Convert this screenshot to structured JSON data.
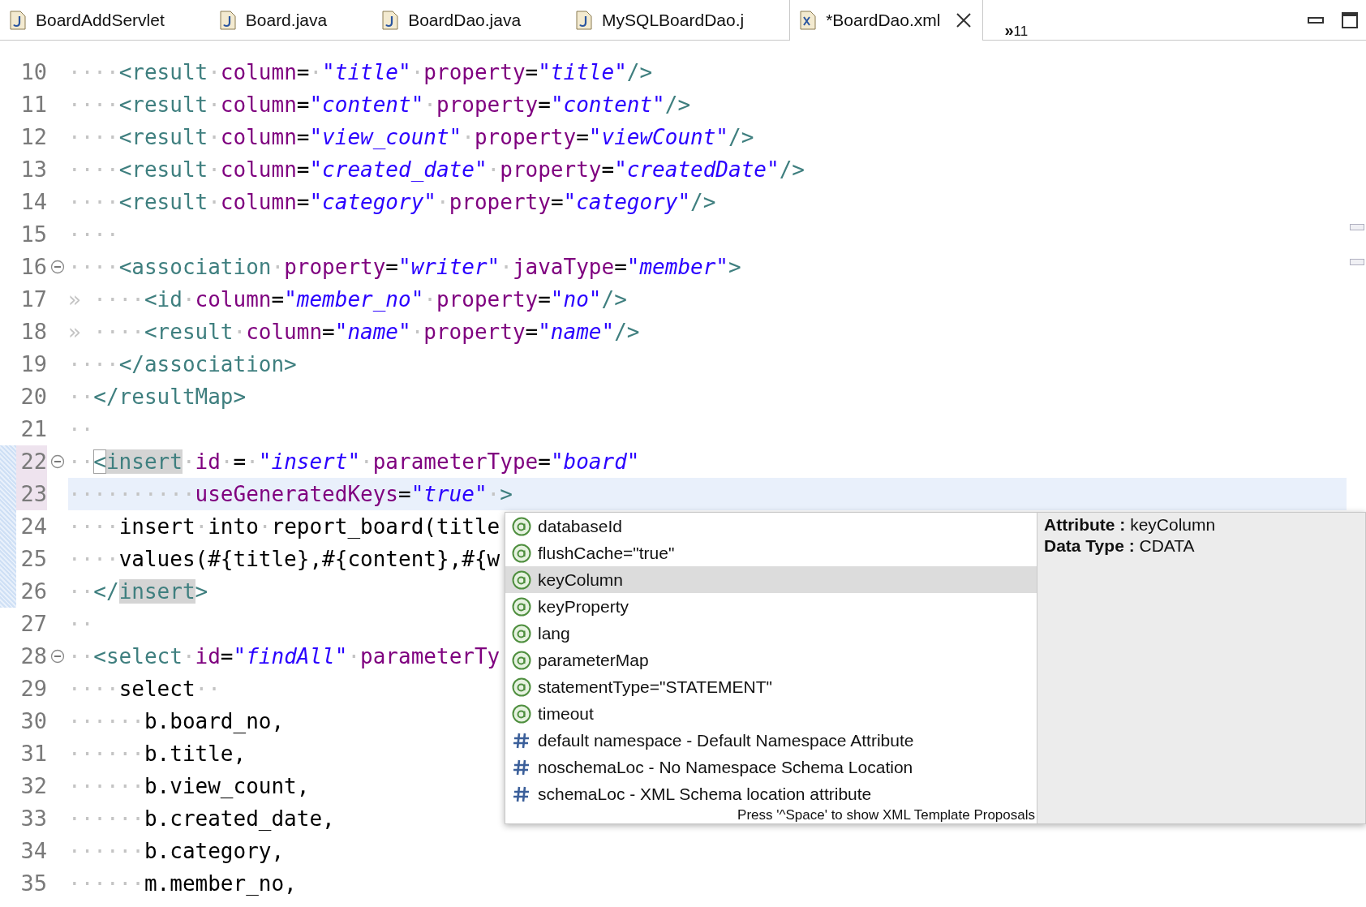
{
  "tabs": [
    {
      "label": "BoardAddServlet",
      "kind": "java",
      "selected": false
    },
    {
      "label": "Board.java",
      "kind": "java",
      "selected": false
    },
    {
      "label": "BoardDao.java",
      "kind": "java",
      "selected": false
    },
    {
      "label": "MySQLBoardDao.j",
      "kind": "java",
      "selected": false
    },
    {
      "label": "*BoardDao.xml",
      "kind": "xml",
      "selected": true
    }
  ],
  "overflow": {
    "chevron": "»",
    "count": "11"
  },
  "lines": [
    {
      "number": "10",
      "fold": false,
      "changed": false,
      "highlighted": false,
      "current": false,
      "tokens": [
        {
          "kind": "ws",
          "text": "····"
        },
        {
          "kind": "tag",
          "text": "<result"
        },
        {
          "kind": "ws",
          "text": "·"
        },
        {
          "kind": "attr",
          "text": "column"
        },
        {
          "kind": "plain",
          "text": "="
        },
        {
          "kind": "ws",
          "text": "·"
        },
        {
          "kind": "value",
          "text": "\"title\""
        },
        {
          "kind": "ws",
          "text": "·"
        },
        {
          "kind": "attr",
          "text": "property"
        },
        {
          "kind": "plain",
          "text": "="
        },
        {
          "kind": "value",
          "text": "\"title\""
        },
        {
          "kind": "tag",
          "text": "/>"
        }
      ]
    },
    {
      "number": "11",
      "fold": false,
      "changed": false,
      "highlighted": false,
      "current": false,
      "tokens": [
        {
          "kind": "ws",
          "text": "····"
        },
        {
          "kind": "tag",
          "text": "<result"
        },
        {
          "kind": "ws",
          "text": "·"
        },
        {
          "kind": "attr",
          "text": "column"
        },
        {
          "kind": "plain",
          "text": "="
        },
        {
          "kind": "value",
          "text": "\"content\""
        },
        {
          "kind": "ws",
          "text": "·"
        },
        {
          "kind": "attr",
          "text": "property"
        },
        {
          "kind": "plain",
          "text": "="
        },
        {
          "kind": "value",
          "text": "\"content\""
        },
        {
          "kind": "tag",
          "text": "/>"
        }
      ]
    },
    {
      "number": "12",
      "fold": false,
      "changed": false,
      "highlighted": false,
      "current": false,
      "tokens": [
        {
          "kind": "ws",
          "text": "····"
        },
        {
          "kind": "tag",
          "text": "<result"
        },
        {
          "kind": "ws",
          "text": "·"
        },
        {
          "kind": "attr",
          "text": "column"
        },
        {
          "kind": "plain",
          "text": "="
        },
        {
          "kind": "value",
          "text": "\"view_count\""
        },
        {
          "kind": "ws",
          "text": "·"
        },
        {
          "kind": "attr",
          "text": "property"
        },
        {
          "kind": "plain",
          "text": "="
        },
        {
          "kind": "value",
          "text": "\"viewCount\""
        },
        {
          "kind": "tag",
          "text": "/>"
        }
      ]
    },
    {
      "number": "13",
      "fold": false,
      "changed": false,
      "highlighted": false,
      "current": false,
      "tokens": [
        {
          "kind": "ws",
          "text": "····"
        },
        {
          "kind": "tag",
          "text": "<result"
        },
        {
          "kind": "ws",
          "text": "·"
        },
        {
          "kind": "attr",
          "text": "column"
        },
        {
          "kind": "plain",
          "text": "="
        },
        {
          "kind": "value",
          "text": "\"created_date\""
        },
        {
          "kind": "ws",
          "text": "·"
        },
        {
          "kind": "attr",
          "text": "property"
        },
        {
          "kind": "plain",
          "text": "="
        },
        {
          "kind": "value",
          "text": "\"createdDate\""
        },
        {
          "kind": "tag",
          "text": "/>"
        }
      ]
    },
    {
      "number": "14",
      "fold": false,
      "changed": false,
      "highlighted": false,
      "current": false,
      "tokens": [
        {
          "kind": "ws",
          "text": "····"
        },
        {
          "kind": "tag",
          "text": "<result"
        },
        {
          "kind": "ws",
          "text": "·"
        },
        {
          "kind": "attr",
          "text": "column"
        },
        {
          "kind": "plain",
          "text": "="
        },
        {
          "kind": "value",
          "text": "\"category\""
        },
        {
          "kind": "ws",
          "text": "·"
        },
        {
          "kind": "attr",
          "text": "property"
        },
        {
          "kind": "plain",
          "text": "="
        },
        {
          "kind": "value",
          "text": "\"category\""
        },
        {
          "kind": "tag",
          "text": "/>"
        }
      ]
    },
    {
      "number": "15",
      "fold": false,
      "changed": false,
      "highlighted": false,
      "current": false,
      "tokens": [
        {
          "kind": "ws",
          "text": "····"
        }
      ]
    },
    {
      "number": "16",
      "fold": true,
      "changed": false,
      "highlighted": false,
      "current": false,
      "tokens": [
        {
          "kind": "ws",
          "text": "····"
        },
        {
          "kind": "tag",
          "text": "<association"
        },
        {
          "kind": "ws",
          "text": "·"
        },
        {
          "kind": "attr",
          "text": "property"
        },
        {
          "kind": "plain",
          "text": "="
        },
        {
          "kind": "value",
          "text": "\"writer\""
        },
        {
          "kind": "ws",
          "text": "·"
        },
        {
          "kind": "attr",
          "text": "javaType"
        },
        {
          "kind": "plain",
          "text": "="
        },
        {
          "kind": "value",
          "text": "\"member\""
        },
        {
          "kind": "tag",
          "text": ">"
        }
      ]
    },
    {
      "number": "17",
      "fold": false,
      "changed": false,
      "highlighted": false,
      "current": false,
      "tokens": [
        {
          "kind": "ws",
          "text": "» ····"
        },
        {
          "kind": "tag",
          "text": "<id"
        },
        {
          "kind": "ws",
          "text": "·"
        },
        {
          "kind": "attr",
          "text": "column"
        },
        {
          "kind": "plain",
          "text": "="
        },
        {
          "kind": "value",
          "text": "\"member_no\""
        },
        {
          "kind": "ws",
          "text": "·"
        },
        {
          "kind": "attr",
          "text": "property"
        },
        {
          "kind": "plain",
          "text": "="
        },
        {
          "kind": "value",
          "text": "\"no\""
        },
        {
          "kind": "tag",
          "text": "/>"
        }
      ]
    },
    {
      "number": "18",
      "fold": false,
      "changed": false,
      "highlighted": false,
      "current": false,
      "tokens": [
        {
          "kind": "ws",
          "text": "» ····"
        },
        {
          "kind": "tag",
          "text": "<result"
        },
        {
          "kind": "ws",
          "text": "·"
        },
        {
          "kind": "attr",
          "text": "column"
        },
        {
          "kind": "plain",
          "text": "="
        },
        {
          "kind": "value",
          "text": "\"name\""
        },
        {
          "kind": "ws",
          "text": "·"
        },
        {
          "kind": "attr",
          "text": "property"
        },
        {
          "kind": "plain",
          "text": "="
        },
        {
          "kind": "value",
          "text": "\"name\""
        },
        {
          "kind": "tag",
          "text": "/>"
        }
      ]
    },
    {
      "number": "19",
      "fold": false,
      "changed": false,
      "highlighted": false,
      "current": false,
      "tokens": [
        {
          "kind": "ws",
          "text": "····"
        },
        {
          "kind": "tag",
          "text": "</association>"
        }
      ]
    },
    {
      "number": "20",
      "fold": false,
      "changed": false,
      "highlighted": false,
      "current": false,
      "tokens": [
        {
          "kind": "ws",
          "text": "··"
        },
        {
          "kind": "tag",
          "text": "</resultMap>"
        }
      ]
    },
    {
      "number": "21",
      "fold": false,
      "changed": false,
      "highlighted": false,
      "current": false,
      "tokens": [
        {
          "kind": "ws",
          "text": "··"
        }
      ]
    },
    {
      "number": "22",
      "fold": true,
      "changed": true,
      "highlighted": true,
      "current": false,
      "tokens": [
        {
          "kind": "ws",
          "text": "··"
        },
        {
          "kind": "tag",
          "text": "<",
          "bracket": true
        },
        {
          "kind": "tag",
          "text": "insert",
          "occurrence": true
        },
        {
          "kind": "ws",
          "text": "·"
        },
        {
          "kind": "attr",
          "text": "id"
        },
        {
          "kind": "ws",
          "text": "·"
        },
        {
          "kind": "plain",
          "text": "="
        },
        {
          "kind": "ws",
          "text": "·"
        },
        {
          "kind": "value",
          "text": "\"insert\""
        },
        {
          "kind": "ws",
          "text": "·"
        },
        {
          "kind": "attr",
          "text": "parameterType"
        },
        {
          "kind": "plain",
          "text": "="
        },
        {
          "kind": "value",
          "text": "\"board\""
        }
      ]
    },
    {
      "number": "23",
      "fold": false,
      "changed": true,
      "highlighted": true,
      "current": true,
      "tokens": [
        {
          "kind": "ws",
          "text": "··········"
        },
        {
          "kind": "attr",
          "text": "useGeneratedKeys"
        },
        {
          "kind": "plain",
          "text": "="
        },
        {
          "kind": "value",
          "text": "\"true\""
        },
        {
          "kind": "ws",
          "text": "·"
        },
        {
          "kind": "tag",
          "text": ">"
        }
      ]
    },
    {
      "number": "24",
      "fold": false,
      "changed": true,
      "highlighted": false,
      "current": false,
      "tokens": [
        {
          "kind": "ws",
          "text": "····"
        },
        {
          "kind": "plain",
          "text": "insert"
        },
        {
          "kind": "ws",
          "text": "·"
        },
        {
          "kind": "plain",
          "text": "into"
        },
        {
          "kind": "ws",
          "text": "·"
        },
        {
          "kind": "plain",
          "text": "report_board(title"
        }
      ]
    },
    {
      "number": "25",
      "fold": false,
      "changed": true,
      "highlighted": false,
      "current": false,
      "tokens": [
        {
          "kind": "ws",
          "text": "····"
        },
        {
          "kind": "plain",
          "text": "values(#{title},#{content},#{w"
        }
      ]
    },
    {
      "number": "26",
      "fold": false,
      "changed": true,
      "highlighted": false,
      "current": false,
      "tokens": [
        {
          "kind": "ws",
          "text": "··"
        },
        {
          "kind": "tag",
          "text": "</"
        },
        {
          "kind": "tag",
          "text": "insert",
          "occurrence": true
        },
        {
          "kind": "tag",
          "text": ">"
        }
      ]
    },
    {
      "number": "27",
      "fold": false,
      "changed": false,
      "highlighted": false,
      "current": false,
      "tokens": [
        {
          "kind": "ws",
          "text": "··"
        }
      ]
    },
    {
      "number": "28",
      "fold": true,
      "changed": false,
      "highlighted": false,
      "current": false,
      "tokens": [
        {
          "kind": "ws",
          "text": "··"
        },
        {
          "kind": "tag",
          "text": "<select"
        },
        {
          "kind": "ws",
          "text": "·"
        },
        {
          "kind": "attr",
          "text": "id"
        },
        {
          "kind": "plain",
          "text": "="
        },
        {
          "kind": "value",
          "text": "\"findAll\""
        },
        {
          "kind": "ws",
          "text": "·"
        },
        {
          "kind": "attr",
          "text": "parameterTy"
        }
      ]
    },
    {
      "number": "29",
      "fold": false,
      "changed": false,
      "highlighted": false,
      "current": false,
      "tokens": [
        {
          "kind": "ws",
          "text": "····"
        },
        {
          "kind": "plain",
          "text": "select"
        },
        {
          "kind": "ws",
          "text": "··"
        }
      ]
    },
    {
      "number": "30",
      "fold": false,
      "changed": false,
      "highlighted": false,
      "current": false,
      "tokens": [
        {
          "kind": "ws",
          "text": "······"
        },
        {
          "kind": "plain",
          "text": "b.board_no,"
        }
      ]
    },
    {
      "number": "31",
      "fold": false,
      "changed": false,
      "highlighted": false,
      "current": false,
      "tokens": [
        {
          "kind": "ws",
          "text": "······"
        },
        {
          "kind": "plain",
          "text": "b.title,"
        }
      ]
    },
    {
      "number": "32",
      "fold": false,
      "changed": false,
      "highlighted": false,
      "current": false,
      "tokens": [
        {
          "kind": "ws",
          "text": "······"
        },
        {
          "kind": "plain",
          "text": "b.view_count,"
        }
      ]
    },
    {
      "number": "33",
      "fold": false,
      "changed": false,
      "highlighted": false,
      "current": false,
      "tokens": [
        {
          "kind": "ws",
          "text": "······"
        },
        {
          "kind": "plain",
          "text": "b.created_date,"
        }
      ]
    },
    {
      "number": "34",
      "fold": false,
      "changed": false,
      "highlighted": false,
      "current": false,
      "tokens": [
        {
          "kind": "ws",
          "text": "······"
        },
        {
          "kind": "plain",
          "text": "b.category,"
        }
      ]
    },
    {
      "number": "35",
      "fold": false,
      "changed": false,
      "highlighted": false,
      "current": false,
      "tokens": [
        {
          "kind": "ws",
          "text": "······"
        },
        {
          "kind": "plain",
          "text": "m.member_no,"
        }
      ]
    }
  ],
  "completion": {
    "proposals": [
      {
        "kind": "attribute",
        "label": "databaseId",
        "selected": false
      },
      {
        "kind": "attribute",
        "label": "flushCache=\"true\"",
        "selected": false
      },
      {
        "kind": "attribute",
        "label": "keyColumn",
        "selected": true
      },
      {
        "kind": "attribute",
        "label": "keyProperty",
        "selected": false
      },
      {
        "kind": "attribute",
        "label": "lang",
        "selected": false
      },
      {
        "kind": "attribute",
        "label": "parameterMap",
        "selected": false
      },
      {
        "kind": "attribute",
        "label": "statementType=\"STATEMENT\"",
        "selected": false
      },
      {
        "kind": "attribute",
        "label": "timeout",
        "selected": false
      },
      {
        "kind": "namespace",
        "label": "default namespace - Default Namespace Attribute",
        "selected": false
      },
      {
        "kind": "namespace",
        "label": "noschemaLoc - No Namespace Schema Location",
        "selected": false
      },
      {
        "kind": "namespace",
        "label": "schemaLoc - XML Schema location attribute",
        "selected": false
      }
    ],
    "footer": "Press '^Space' to show XML Template Proposals",
    "details": [
      "**Attribute :** keyColumn",
      "**Data Type :** CDATA"
    ]
  }
}
